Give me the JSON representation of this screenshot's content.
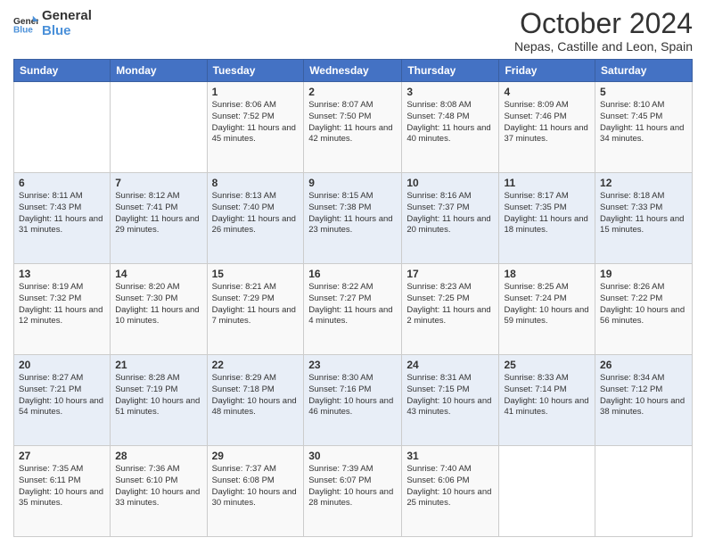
{
  "logo": {
    "line1": "General",
    "line2": "Blue"
  },
  "header": {
    "month": "October 2024",
    "location": "Nepas, Castille and Leon, Spain"
  },
  "days_of_week": [
    "Sunday",
    "Monday",
    "Tuesday",
    "Wednesday",
    "Thursday",
    "Friday",
    "Saturday"
  ],
  "weeks": [
    [
      {
        "day": "",
        "info": ""
      },
      {
        "day": "",
        "info": ""
      },
      {
        "day": "1",
        "info": "Sunrise: 8:06 AM\nSunset: 7:52 PM\nDaylight: 11 hours and 45 minutes."
      },
      {
        "day": "2",
        "info": "Sunrise: 8:07 AM\nSunset: 7:50 PM\nDaylight: 11 hours and 42 minutes."
      },
      {
        "day": "3",
        "info": "Sunrise: 8:08 AM\nSunset: 7:48 PM\nDaylight: 11 hours and 40 minutes."
      },
      {
        "day": "4",
        "info": "Sunrise: 8:09 AM\nSunset: 7:46 PM\nDaylight: 11 hours and 37 minutes."
      },
      {
        "day": "5",
        "info": "Sunrise: 8:10 AM\nSunset: 7:45 PM\nDaylight: 11 hours and 34 minutes."
      }
    ],
    [
      {
        "day": "6",
        "info": "Sunrise: 8:11 AM\nSunset: 7:43 PM\nDaylight: 11 hours and 31 minutes."
      },
      {
        "day": "7",
        "info": "Sunrise: 8:12 AM\nSunset: 7:41 PM\nDaylight: 11 hours and 29 minutes."
      },
      {
        "day": "8",
        "info": "Sunrise: 8:13 AM\nSunset: 7:40 PM\nDaylight: 11 hours and 26 minutes."
      },
      {
        "day": "9",
        "info": "Sunrise: 8:15 AM\nSunset: 7:38 PM\nDaylight: 11 hours and 23 minutes."
      },
      {
        "day": "10",
        "info": "Sunrise: 8:16 AM\nSunset: 7:37 PM\nDaylight: 11 hours and 20 minutes."
      },
      {
        "day": "11",
        "info": "Sunrise: 8:17 AM\nSunset: 7:35 PM\nDaylight: 11 hours and 18 minutes."
      },
      {
        "day": "12",
        "info": "Sunrise: 8:18 AM\nSunset: 7:33 PM\nDaylight: 11 hours and 15 minutes."
      }
    ],
    [
      {
        "day": "13",
        "info": "Sunrise: 8:19 AM\nSunset: 7:32 PM\nDaylight: 11 hours and 12 minutes."
      },
      {
        "day": "14",
        "info": "Sunrise: 8:20 AM\nSunset: 7:30 PM\nDaylight: 11 hours and 10 minutes."
      },
      {
        "day": "15",
        "info": "Sunrise: 8:21 AM\nSunset: 7:29 PM\nDaylight: 11 hours and 7 minutes."
      },
      {
        "day": "16",
        "info": "Sunrise: 8:22 AM\nSunset: 7:27 PM\nDaylight: 11 hours and 4 minutes."
      },
      {
        "day": "17",
        "info": "Sunrise: 8:23 AM\nSunset: 7:25 PM\nDaylight: 11 hours and 2 minutes."
      },
      {
        "day": "18",
        "info": "Sunrise: 8:25 AM\nSunset: 7:24 PM\nDaylight: 10 hours and 59 minutes."
      },
      {
        "day": "19",
        "info": "Sunrise: 8:26 AM\nSunset: 7:22 PM\nDaylight: 10 hours and 56 minutes."
      }
    ],
    [
      {
        "day": "20",
        "info": "Sunrise: 8:27 AM\nSunset: 7:21 PM\nDaylight: 10 hours and 54 minutes."
      },
      {
        "day": "21",
        "info": "Sunrise: 8:28 AM\nSunset: 7:19 PM\nDaylight: 10 hours and 51 minutes."
      },
      {
        "day": "22",
        "info": "Sunrise: 8:29 AM\nSunset: 7:18 PM\nDaylight: 10 hours and 48 minutes."
      },
      {
        "day": "23",
        "info": "Sunrise: 8:30 AM\nSunset: 7:16 PM\nDaylight: 10 hours and 46 minutes."
      },
      {
        "day": "24",
        "info": "Sunrise: 8:31 AM\nSunset: 7:15 PM\nDaylight: 10 hours and 43 minutes."
      },
      {
        "day": "25",
        "info": "Sunrise: 8:33 AM\nSunset: 7:14 PM\nDaylight: 10 hours and 41 minutes."
      },
      {
        "day": "26",
        "info": "Sunrise: 8:34 AM\nSunset: 7:12 PM\nDaylight: 10 hours and 38 minutes."
      }
    ],
    [
      {
        "day": "27",
        "info": "Sunrise: 7:35 AM\nSunset: 6:11 PM\nDaylight: 10 hours and 35 minutes."
      },
      {
        "day": "28",
        "info": "Sunrise: 7:36 AM\nSunset: 6:10 PM\nDaylight: 10 hours and 33 minutes."
      },
      {
        "day": "29",
        "info": "Sunrise: 7:37 AM\nSunset: 6:08 PM\nDaylight: 10 hours and 30 minutes."
      },
      {
        "day": "30",
        "info": "Sunrise: 7:39 AM\nSunset: 6:07 PM\nDaylight: 10 hours and 28 minutes."
      },
      {
        "day": "31",
        "info": "Sunrise: 7:40 AM\nSunset: 6:06 PM\nDaylight: 10 hours and 25 minutes."
      },
      {
        "day": "",
        "info": ""
      },
      {
        "day": "",
        "info": ""
      }
    ]
  ]
}
